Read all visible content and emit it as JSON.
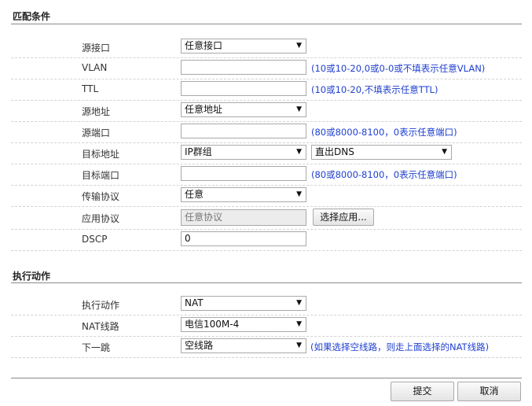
{
  "match": {
    "title": "匹配条件",
    "src_if": {
      "label": "源接口",
      "value": "任意接口"
    },
    "vlan": {
      "label": "VLAN",
      "value": "",
      "hint": "(10或10-20,0或0-0或不填表示任意VLAN)"
    },
    "ttl": {
      "label": "TTL",
      "value": "",
      "hint": "(10或10-20,不填表示任意TTL)"
    },
    "src_addr": {
      "label": "源地址",
      "value": "任意地址"
    },
    "src_port": {
      "label": "源端口",
      "value": "",
      "hint": "(80或8000-8100，0表示任意端口)"
    },
    "dst_addr": {
      "label": "目标地址",
      "value": "IP群组",
      "value2": "直出DNS"
    },
    "dst_port": {
      "label": "目标端口",
      "value": "",
      "hint": "(80或8000-8100，0表示任意端口)"
    },
    "proto": {
      "label": "传输协议",
      "value": "任意"
    },
    "app": {
      "label": "应用协议",
      "value": "任意协议",
      "button": "选择应用..."
    },
    "dscp": {
      "label": "DSCP",
      "value": "0"
    }
  },
  "action": {
    "title": "执行动作",
    "act": {
      "label": "执行动作",
      "value": "NAT"
    },
    "nat_line": {
      "label": "NAT线路",
      "value": "电信100M-4"
    },
    "next_hop": {
      "label": "下一跳",
      "value": "空线路",
      "hint": "(如果选择空线路，则走上面选择的NAT线路)"
    }
  },
  "footer": {
    "submit": "提交",
    "cancel": "取消"
  },
  "icons": {
    "dropdown": "▼"
  }
}
